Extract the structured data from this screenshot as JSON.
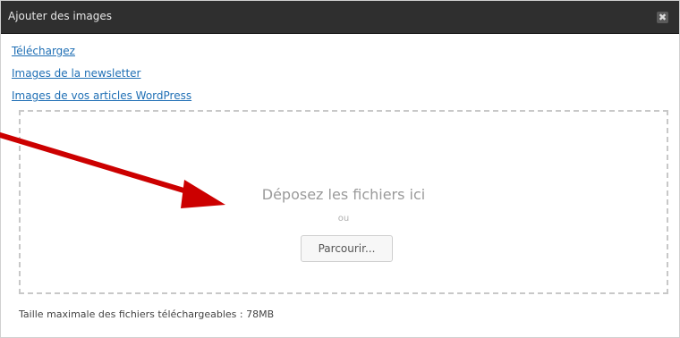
{
  "dialog": {
    "title": "Ajouter des images",
    "close_icon": "close-icon",
    "close_glyph": "✖"
  },
  "links": {
    "upload": "Téléchargez",
    "newsletter_images": "Images de la newsletter",
    "article_images": "Images de vos articles WordPress"
  },
  "dropzone": {
    "title": "Déposez les fichiers ici",
    "or": "ou",
    "browse_label": "Parcourir..."
  },
  "footer": {
    "max_size_text": "Taille maximale des fichiers téléchargeables : 78MB"
  },
  "annotation": {
    "arrow_color": "#cc0000",
    "arrow_icon": "red-arrow-icon"
  },
  "colors": {
    "titlebar": "#2f2f2f",
    "link": "#1f6fb5",
    "dashed_border": "#c8c8c8"
  }
}
